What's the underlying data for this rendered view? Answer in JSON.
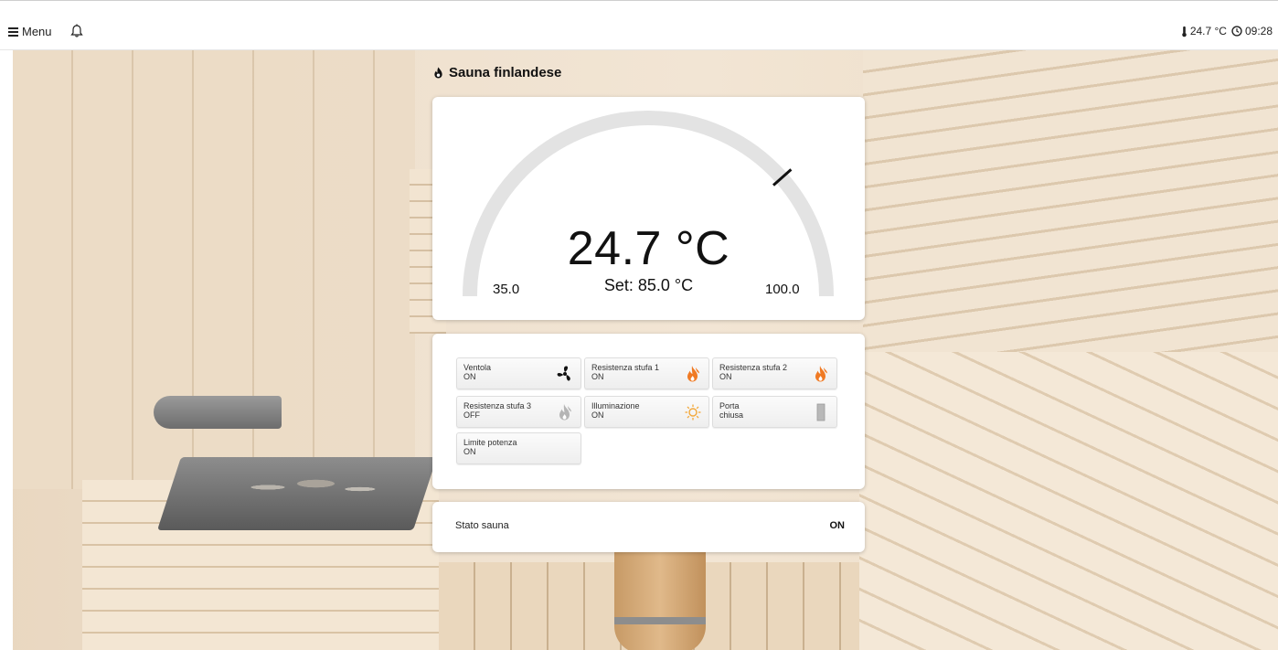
{
  "topbar": {
    "menu_label": "Menu",
    "temperature": "24.7 °C",
    "time": "09:28"
  },
  "icons": {
    "menu": "hamburger-icon",
    "notifications": "bell-icon",
    "thermometer": "thermometer-icon",
    "clock": "clock-icon",
    "sauna": "flame-drop-icon"
  },
  "page": {
    "title": "Sauna finlandese"
  },
  "gauge": {
    "current_temp": "24.7 °C",
    "setpoint_label": "Set: 85.0 °C",
    "min_label": "35.0",
    "max_label": "100.0",
    "min": 35.0,
    "max": 100.0,
    "setpoint": 85.0,
    "current": 24.7
  },
  "devices": [
    {
      "label": "Ventola",
      "value": "ON",
      "icon": "fan-icon"
    },
    {
      "label": "Resistenza stufa 1",
      "value": "ON",
      "icon": "flame-on-icon"
    },
    {
      "label": "Resistenza stufa 2",
      "value": "ON",
      "icon": "flame-on-icon"
    },
    {
      "label": "Resistenza stufa 3",
      "value": "OFF",
      "icon": "flame-off-icon"
    },
    {
      "label": "Illuminazione",
      "value": "ON",
      "icon": "sun-icon"
    },
    {
      "label": "Porta",
      "value": "chiusa",
      "icon": "door-icon"
    },
    {
      "label": "Limite potenza",
      "value": "ON",
      "icon": ""
    }
  ],
  "state": {
    "label": "Stato sauna",
    "value": "ON"
  },
  "colors": {
    "flame_on": "#f07a24",
    "flame_off": "#b5b5b5",
    "gauge_track": "#e3e3e3",
    "needle": "#111111",
    "sun": "#f3a83a",
    "door": "#b8b8b8"
  }
}
